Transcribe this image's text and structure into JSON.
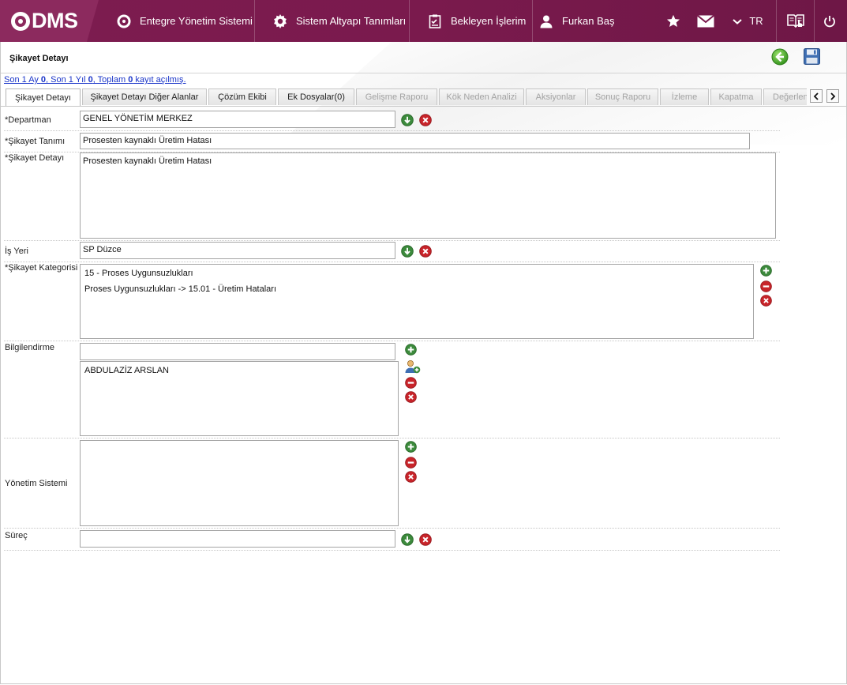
{
  "topbar": {
    "logo_text": "DMS",
    "nav": [
      {
        "label": "Entegre Yönetim Sistemi",
        "icon": "qdms-icon"
      },
      {
        "label": "Sistem Altyapı Tanımları",
        "icon": "gear-icon"
      },
      {
        "label": "Bekleyen İşlerim",
        "icon": "clipboard-icon"
      },
      {
        "label": "Furkan Baş",
        "icon": "user-icon"
      }
    ],
    "language": "TR",
    "icons": [
      "star-icon",
      "mail-icon",
      "chevron-down-icon",
      "guide-book-icon",
      "power-icon"
    ],
    "colors": {
      "bar": "#7a1a4d",
      "logo_block": "#8c2a5e"
    }
  },
  "page": {
    "title": "Şikayet Detayı",
    "actions": {
      "back_icon": "back-arrow-icon",
      "save_icon": "save-disk-icon"
    },
    "stats": {
      "prefix1": "Son 1 Ay ",
      "value1": "0",
      "prefix2": ", Son 1 Yıl ",
      "value2": "0",
      "prefix3": ", Toplam ",
      "value3": "0",
      "suffix": " kayıt açılmış."
    }
  },
  "tabs": [
    {
      "label": "Şikayet Detayı",
      "state": "active"
    },
    {
      "label": "Şikayet Detayı Diğer Alanlar",
      "state": "enabled"
    },
    {
      "label": "Çözüm Ekibi",
      "state": "enabled"
    },
    {
      "label": "Ek Dosyalar(0)",
      "state": "enabled"
    },
    {
      "label": "Gelişme Raporu",
      "state": "disabled"
    },
    {
      "label": "Kök Neden Analizi",
      "state": "disabled"
    },
    {
      "label": "Aksiyonlar",
      "state": "disabled"
    },
    {
      "label": "Sonuç Raporu",
      "state": "disabled"
    },
    {
      "label": "İzleme",
      "state": "disabled"
    },
    {
      "label": "Kapatma",
      "state": "disabled"
    },
    {
      "label": "Değerlen",
      "state": "disabled"
    }
  ],
  "form": {
    "departman": {
      "label": "*Departman",
      "value": "GENEL YÖNETİM MERKEZ"
    },
    "sikayet_tanimi": {
      "label": "*Şikayet Tanımı",
      "value": "Prosesten kaynaklı Üretim Hatası"
    },
    "sikayet_detayi": {
      "label": "*Şikayet Detayı",
      "value": "Prosesten kaynaklı Üretim Hatası"
    },
    "is_yeri": {
      "label": "İş Yeri",
      "value": "SP Düzce"
    },
    "sikayet_kategorisi": {
      "label": "*Şikayet Kategorisi",
      "items": [
        "15 - Proses Uygunsuzlukları",
        "Proses Uygunsuzlukları -> 15.01 - Üretim Hataları"
      ]
    },
    "bilgilendirme": {
      "label": "Bilgilendirme",
      "input_value": "",
      "items": [
        "ABDULAZİZ ARSLAN"
      ]
    },
    "yonetim_sistemi": {
      "label": "Yönetim Sistemi",
      "items": []
    },
    "surec": {
      "label": "Süreç",
      "value": ""
    }
  }
}
